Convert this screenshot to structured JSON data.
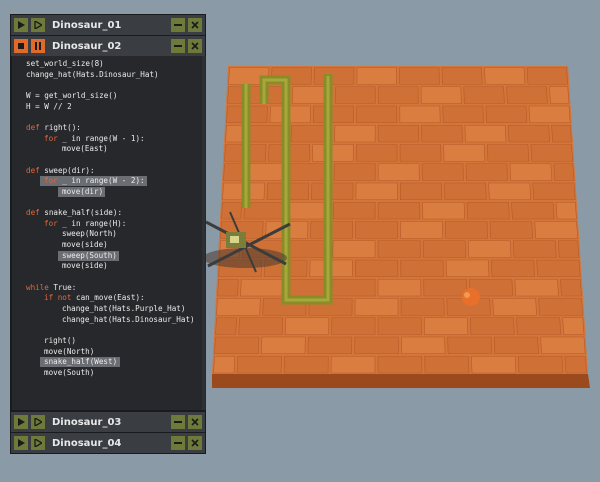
{
  "windows": [
    {
      "title": "Dinosaur_01",
      "state": "stopped"
    },
    {
      "title": "Dinosaur_02",
      "state": "running"
    },
    {
      "title": "Dinosaur_03",
      "state": "stopped"
    },
    {
      "title": "Dinosaur_04",
      "state": "stopped"
    }
  ],
  "editor": {
    "lines": [
      {
        "text": "set_world_size(8)",
        "indent": 0
      },
      {
        "text": "change_hat(Hats.Dinosaur_Hat)",
        "indent": 0
      },
      {
        "text": "",
        "indent": 0
      },
      {
        "text": "W = get_world_size()",
        "indent": 0
      },
      {
        "text": "H = W // 2",
        "indent": 0
      },
      {
        "text": "",
        "indent": 0
      },
      {
        "text": "def right():",
        "indent": 0,
        "kw": "def"
      },
      {
        "text": "for _ in range(W - 1):",
        "indent": 1,
        "kw": "for"
      },
      {
        "text": "move(East)",
        "indent": 2
      },
      {
        "text": "",
        "indent": 0
      },
      {
        "text": "def sweep(dir):",
        "indent": 0,
        "kw": "def"
      },
      {
        "text": "for _ in range(W - 2):",
        "indent": 1,
        "kw": "for",
        "highlight": true
      },
      {
        "text": "move(dir)",
        "indent": 2,
        "highlight": true
      },
      {
        "text": "",
        "indent": 0
      },
      {
        "text": "def snake_half(side):",
        "indent": 0,
        "kw": "def"
      },
      {
        "text": "for _ in range(H):",
        "indent": 1,
        "kw": "for"
      },
      {
        "text": "sweep(North)",
        "indent": 2
      },
      {
        "text": "move(side)",
        "indent": 2
      },
      {
        "text": "sweep(South)",
        "indent": 2,
        "highlight": true
      },
      {
        "text": "move(side)",
        "indent": 2
      },
      {
        "text": "",
        "indent": 0
      },
      {
        "text": "while True:",
        "indent": 0,
        "kw": "while"
      },
      {
        "text": "if not can_move(East):",
        "indent": 1,
        "kw": "if not"
      },
      {
        "text": "change_hat(Hats.Purple_Hat)",
        "indent": 2
      },
      {
        "text": "change_hat(Hats.Dinosaur_Hat)",
        "indent": 2
      },
      {
        "text": "",
        "indent": 0
      },
      {
        "text": "right()",
        "indent": 1
      },
      {
        "text": "move(North)",
        "indent": 1
      },
      {
        "text": "snake_half(West)",
        "indent": 1,
        "highlight": true
      },
      {
        "text": "move(South)",
        "indent": 1
      }
    ]
  },
  "colors": {
    "accent_green": "#6e7a3a",
    "stop_orange": "#e06a2a",
    "keyword": "#e4663a",
    "tile": "#d4763a",
    "trail": "#8a8c2a"
  },
  "icons": [
    "play-icon",
    "step-icon",
    "stop-icon",
    "pause-icon",
    "minimize-icon",
    "close-icon"
  ]
}
